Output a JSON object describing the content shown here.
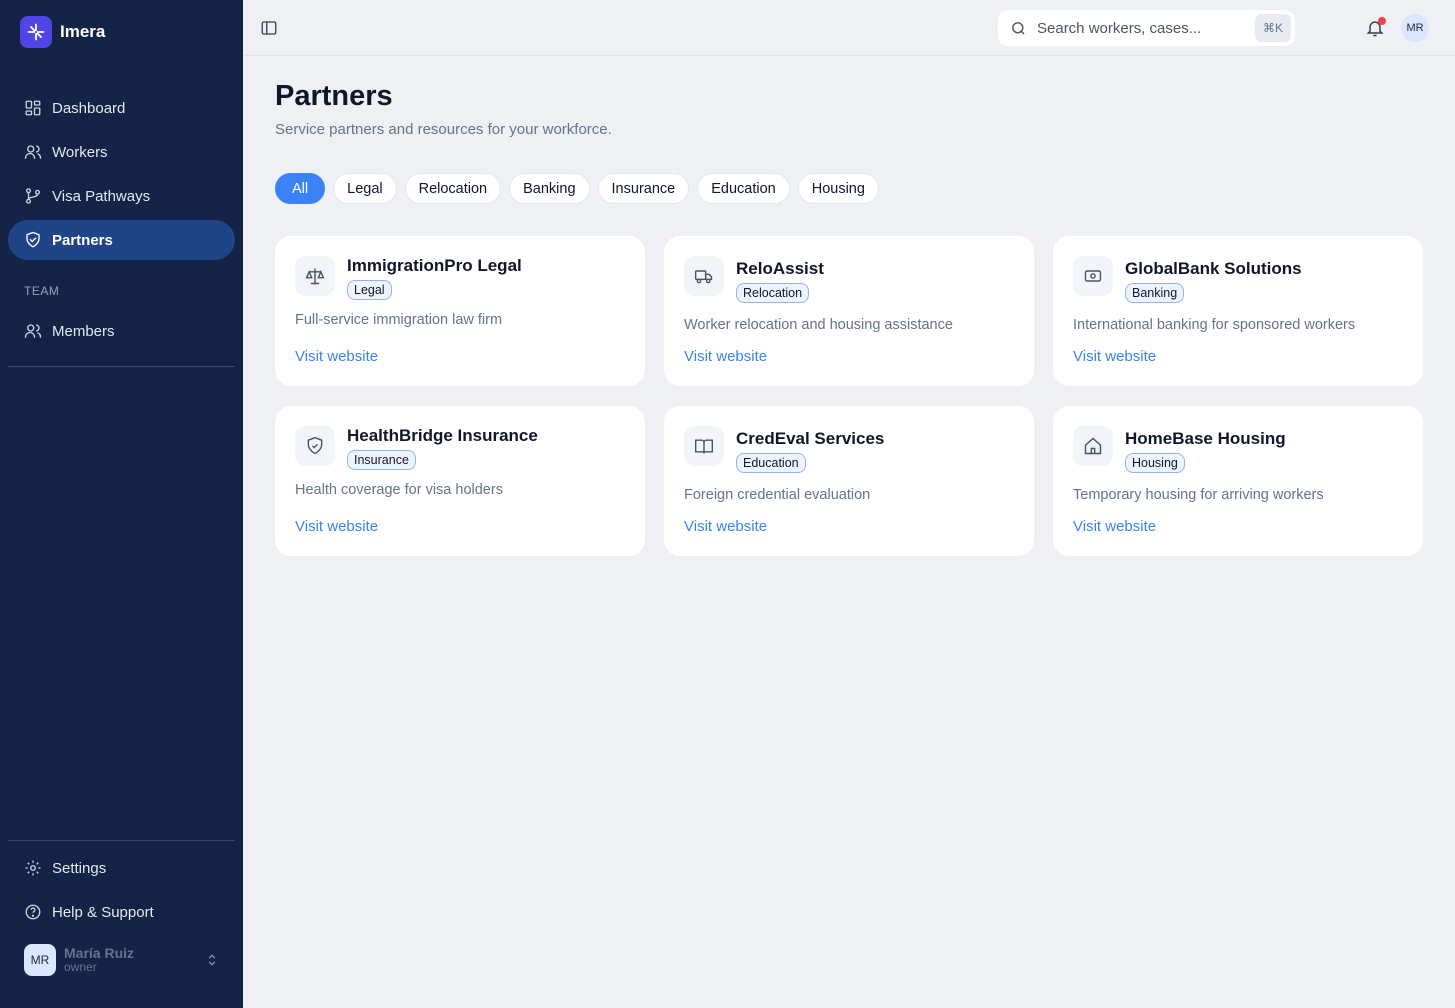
{
  "app": {
    "name": "Imera"
  },
  "sidebar": {
    "items": [
      {
        "label": "Dashboard",
        "icon": "dashboard-icon"
      },
      {
        "label": "Workers",
        "icon": "users-icon"
      },
      {
        "label": "Visa Pathways",
        "icon": "git-branch-icon"
      },
      {
        "label": "Partners",
        "icon": "handshake-icon",
        "active": true
      }
    ],
    "team_label": "TEAM",
    "team_items": [
      {
        "label": "Members",
        "icon": "users-icon"
      }
    ],
    "bottom_items": [
      {
        "label": "Settings",
        "icon": "gear-icon"
      },
      {
        "label": "Help & Support",
        "icon": "help-icon"
      }
    ],
    "user": {
      "initials": "MR",
      "name": "María Ruiz",
      "role": "owner"
    }
  },
  "topbar": {
    "search_placeholder": "Search workers, cases...",
    "shortcut": "⌘K",
    "avatar_initials": "MR"
  },
  "main": {
    "title": "Partners",
    "subtitle": "Service partners and resources for your workforce.",
    "filters": [
      "All",
      "Legal",
      "Relocation",
      "Banking",
      "Insurance",
      "Education",
      "Housing"
    ],
    "active_filter": "All",
    "link_label": "Visit website",
    "partners": [
      {
        "name": "ImmigrationPro Legal",
        "category": "Legal",
        "description": "Full-service immigration law firm",
        "icon": "scale-icon"
      },
      {
        "name": "ReloAssist",
        "category": "Relocation",
        "description": "Worker relocation and housing assistance",
        "icon": "truck-icon"
      },
      {
        "name": "GlobalBank Solutions",
        "category": "Banking",
        "description": "International banking for sponsored workers",
        "icon": "banknote-icon"
      },
      {
        "name": "HealthBridge Insurance",
        "category": "Insurance",
        "description": "Health coverage for visa holders",
        "icon": "shield-check-icon"
      },
      {
        "name": "CredEval Services",
        "category": "Education",
        "description": "Foreign credential evaluation",
        "icon": "book-open-icon"
      },
      {
        "name": "HomeBase Housing",
        "category": "Housing",
        "description": "Temporary housing for arriving workers",
        "icon": "home-icon"
      }
    ]
  },
  "colors": {
    "sidebar_bg": "#152347",
    "active_nav": "#1f4487",
    "accent": "#3b82f6",
    "page_bg": "#eef0f4"
  }
}
